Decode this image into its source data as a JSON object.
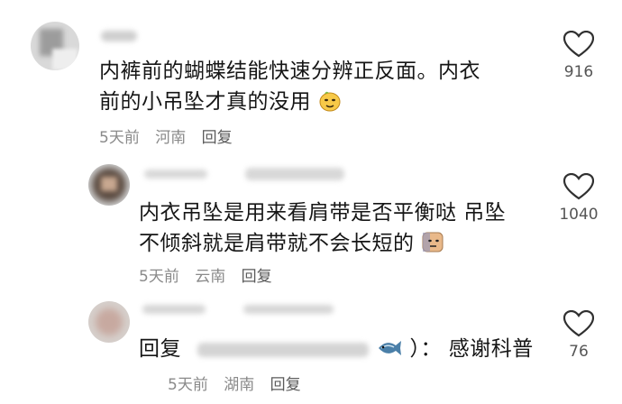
{
  "comments": [
    {
      "text": "内裤前的蝴蝶结能快速分辨正反面。内衣前的小吊坠才真的没用",
      "time": "5天前",
      "location": "河南",
      "reply": "回复",
      "likes": "916"
    },
    {
      "text": "内衣吊坠是用来看肩带是否平衡哒 吊坠不倾斜就是肩带就不会长短的",
      "time": "5天前",
      "location": "云南",
      "reply": "回复",
      "likes": "1040"
    },
    {
      "prefix": "回复",
      "after_name": "）：",
      "text": "感谢科普",
      "time": "5天前",
      "location": "湖南",
      "reply": "回复",
      "likes": "76"
    }
  ]
}
